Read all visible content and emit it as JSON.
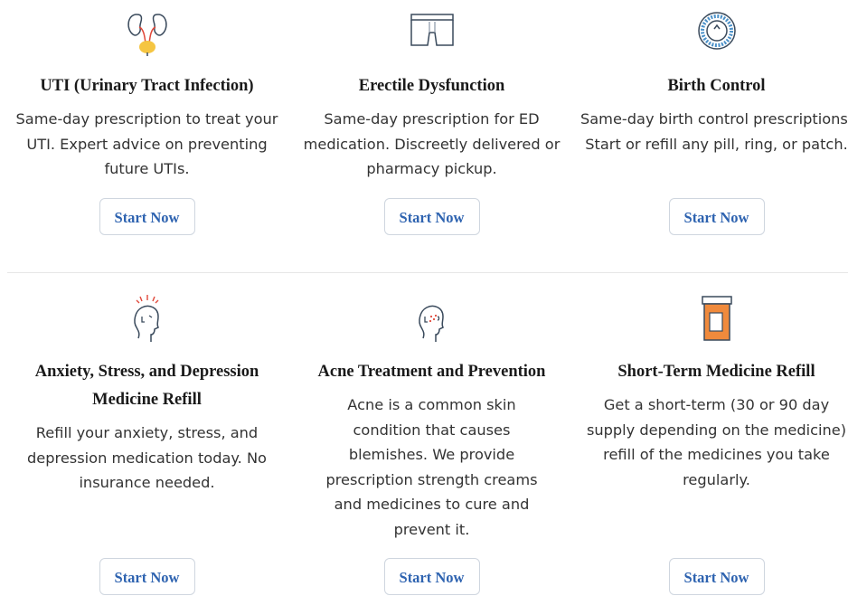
{
  "cards": [
    {
      "icon": "kidneys-icon",
      "title": "UTI (Urinary Tract Infection)",
      "desc": "Same-day prescription to treat your UTI. Expert advice on preventing future UTIs.",
      "button": "Start Now"
    },
    {
      "icon": "boxer-shorts-icon",
      "title": "Erectile Dysfunction",
      "desc": "Same-day prescription for ED medication. Discreetly delivered or pharmacy pickup.",
      "button": "Start Now"
    },
    {
      "icon": "pill-dial-icon",
      "title": "Birth Control",
      "desc": "Same-day birth control prescriptions. Start or refill any pill, ring, or patch.",
      "button": "Start Now"
    },
    {
      "icon": "stressed-head-icon",
      "title": "Anxiety, Stress, and Depression Medicine Refill",
      "desc": "Refill your anxiety, stress, and depression medication today. No insurance needed.",
      "button": "Start Now"
    },
    {
      "icon": "acne-face-icon",
      "title": "Acne Treatment and Prevention",
      "desc": "Acne is a common skin condition that causes blemishes. We provide prescription strength creams and medicines to cure and prevent it.",
      "button": "Start Now"
    },
    {
      "icon": "pill-bottle-icon",
      "title": "Short-Term Medicine Refill",
      "desc": "Get a short-term (30 or 90 day supply depending on the medicine) refill of the medicines you take regularly.",
      "button": "Start Now"
    }
  ],
  "colors": {
    "button_text": "#2e63b0",
    "button_border": "#cfd6df",
    "icon_stroke": "#3a4a5c",
    "accent_orange": "#f08a3c",
    "accent_red": "#e0483a",
    "accent_yellow": "#f5c542"
  }
}
